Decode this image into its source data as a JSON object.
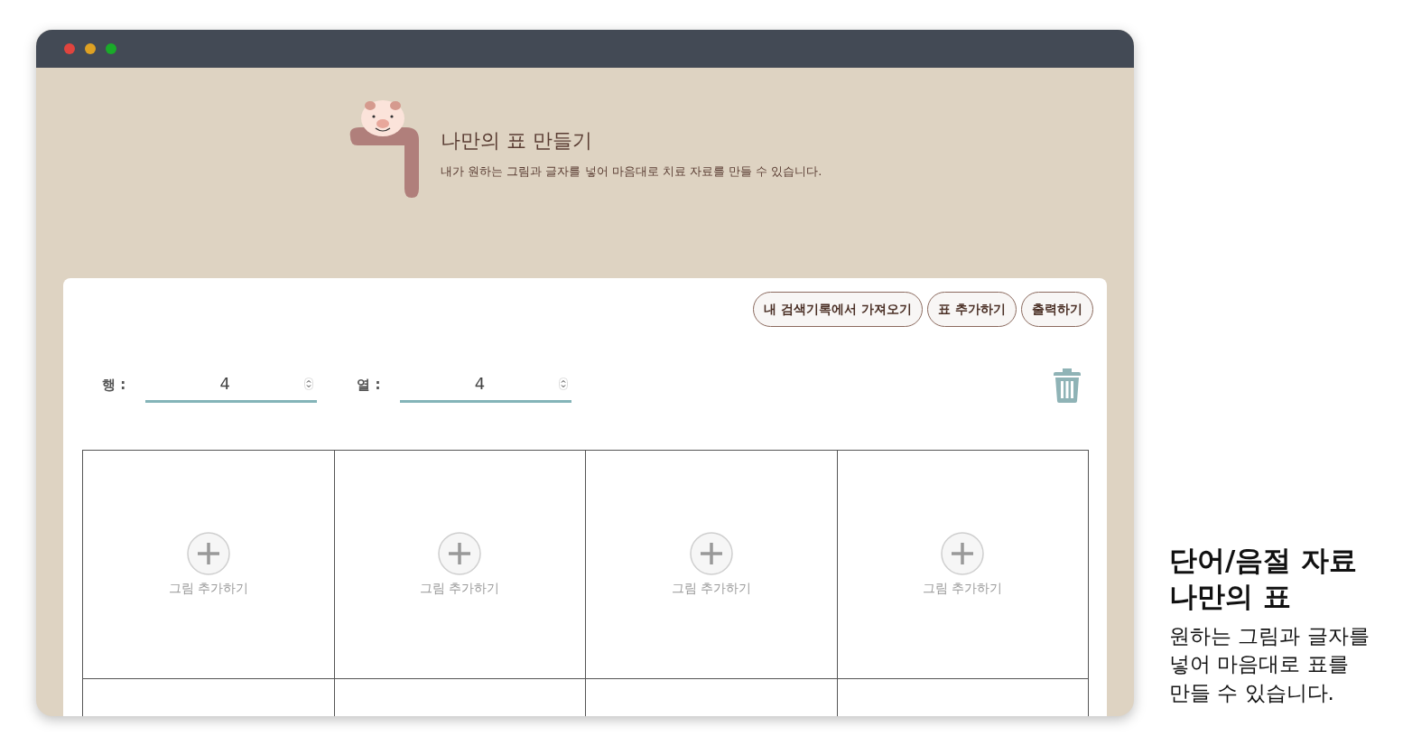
{
  "window": {
    "title_bar": {
      "buttons": [
        {
          "color": "#e0443e"
        },
        {
          "color": "#dea123"
        },
        {
          "color": "#1aab29"
        }
      ]
    }
  },
  "header": {
    "title": "나만의 표 만들기",
    "subtitle": "내가 원하는 그림과 글자를 넣어 마음대로 치료 자료를 만들 수 있습니다."
  },
  "toolbar": {
    "buttons": [
      "내 검색기록에서 가져오기",
      "표 추가하기",
      "출력하기"
    ]
  },
  "size_fields": [
    {
      "label": "행 :",
      "value": "4"
    },
    {
      "label": "열 :",
      "value": "4"
    }
  ],
  "table": {
    "rows": [
      {
        "cells": [
          {
            "kind": "add-picture",
            "label": "그림 추가하기"
          },
          {
            "kind": "add-picture",
            "label": "그림 추가하기"
          },
          {
            "kind": "add-picture",
            "label": "그림 추가하기"
          },
          {
            "kind": "add-picture",
            "label": "그림 추가하기"
          }
        ]
      },
      {
        "cells": [
          {
            "kind": "empty"
          },
          {
            "kind": "empty"
          },
          {
            "kind": "empty"
          },
          {
            "kind": "empty"
          }
        ]
      }
    ]
  },
  "caption": {
    "title_lines": [
      "단어/음절 자료",
      "나만의 표"
    ],
    "description_lines": [
      "원하는 그림과 글자를",
      "넣어 마음대로 표를",
      "만들 수 있습니다."
    ]
  }
}
